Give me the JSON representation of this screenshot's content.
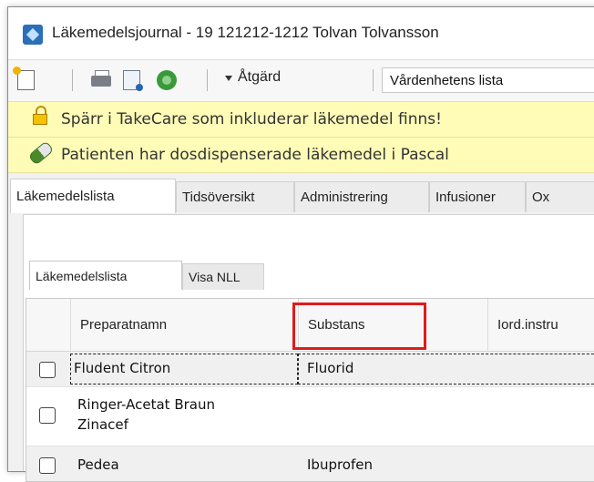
{
  "window": {
    "title": "Läkemedelsjournal - 19 121212-1212 Tolvan Tolvansson"
  },
  "toolbar": {
    "action_label": "Åtgärd",
    "list_value": "Vårdenhetens lista"
  },
  "banners": [
    {
      "text": "Spärr i TakeCare som inkluderar läkemedel finns!"
    },
    {
      "text": "Patienten har dosdispenserade läkemedel i Pascal"
    }
  ],
  "main_tabs": [
    {
      "label": "Läkemedelslista"
    },
    {
      "label": "Tidsöversikt"
    },
    {
      "label": "Administrering"
    },
    {
      "label": "Infusioner"
    },
    {
      "label": "Ox"
    }
  ],
  "sub_tabs": [
    {
      "label": "Läkemedelslista"
    },
    {
      "label": "Visa NLL"
    }
  ],
  "table": {
    "columns": [
      "Preparatnamn",
      "Substans",
      "Iord.instru"
    ],
    "rows": [
      {
        "name_line1": "Fludent Citron",
        "name_line2": "",
        "substance": "Fluorid"
      },
      {
        "name_line1": "Ringer-Acetat Braun",
        "name_line2": "Zinacef",
        "substance": ""
      },
      {
        "name_line1": "Pedea",
        "name_line2": "",
        "substance": "Ibuprofen"
      }
    ]
  },
  "colors": {
    "highlight": "#e11b1b",
    "banner_bg": "#fffcb8"
  }
}
